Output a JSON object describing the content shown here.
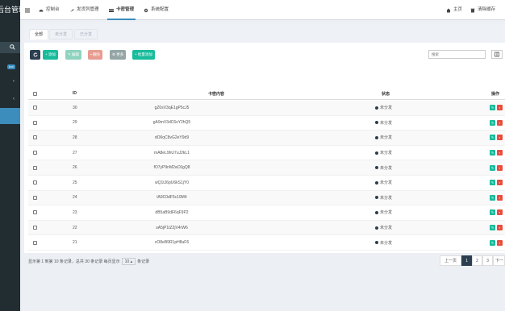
{
  "sidebar": {
    "logo": "后台管理系",
    "badge": "hot",
    "chevrons": [
      "‹",
      "‹"
    ]
  },
  "topnav": {
    "items": [
      {
        "label": "控制台",
        "icon": "dashboard-icon"
      },
      {
        "label": "发货列管理",
        "icon": "wrench-icon"
      },
      {
        "label": "卡密管理",
        "icon": "card-icon"
      },
      {
        "label": "系统配置",
        "icon": "gear-icon"
      }
    ],
    "home": "主页",
    "clear_cache": "清除缓存"
  },
  "tabs": [
    "全部",
    "未分发",
    "已分发"
  ],
  "toolbar": {
    "add": "添加",
    "edit": "编辑",
    "delete": "删除",
    "more": "更多",
    "batch_add": "批量添加",
    "search_placeholder": "搜索"
  },
  "table": {
    "headers": {
      "id": "ID",
      "content": "卡密内容",
      "status": "状态",
      "action": "操作"
    },
    "rows": [
      {
        "id": "30",
        "content": "gZ0sV3qE1gP5cJ5",
        "status": "未分发"
      },
      {
        "id": "29",
        "content": "gA9mV3dC6sY2hQ5",
        "status": "未分发"
      },
      {
        "id": "28",
        "content": "dO6qC8vG2eY9d9",
        "status": "未分发"
      },
      {
        "id": "27",
        "content": "mA8eL9hU7uJ2kL1",
        "status": "未分发"
      },
      {
        "id": "26",
        "content": "fO7yP9nM2aC6gQ8",
        "status": "未分发"
      },
      {
        "id": "25",
        "content": "wQ1tJ6pU6kS1jY0",
        "status": "未分发"
      },
      {
        "id": "24",
        "content": "lA9C0dF5c19M4",
        "status": "未分发"
      },
      {
        "id": "23",
        "content": "dB5aB9dF6qF9P2",
        "status": "未分发"
      },
      {
        "id": "22",
        "content": "sA5jP1tZ2jV4rW6",
        "status": "未分发"
      },
      {
        "id": "21",
        "content": "vO8eB9R1pH8uF6",
        "status": "未分发"
      }
    ]
  },
  "footer": {
    "summary": "显示第 1 到第 10 条记录，总共 30 条记录 每页显示",
    "page_size": "10",
    "suffix": "条记录"
  },
  "pagination": {
    "prev": "上一页",
    "pages": [
      "1",
      "2",
      "3"
    ],
    "next": "下一页"
  },
  "colors": {
    "accent": "#3c8dbc",
    "green": "#18bc9c",
    "sidebar": "#222d32",
    "danger": "#e74c3c"
  }
}
